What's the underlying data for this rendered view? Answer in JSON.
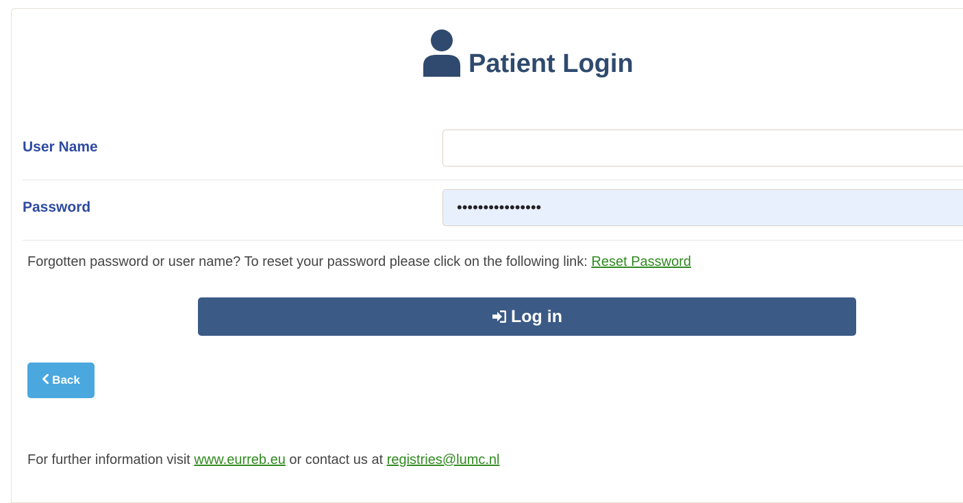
{
  "header": {
    "title": "Patient Login",
    "icon": "user-icon"
  },
  "form": {
    "username_label": "User Name",
    "username_value": "",
    "password_label": "Password",
    "password_value": "••••••••••••••••"
  },
  "forgot": {
    "text": "Forgotten password or user name? To reset your password please click on the following link: ",
    "link_label": "Reset Password"
  },
  "buttons": {
    "login_label": "Log in",
    "login_icon": "sign-in-icon",
    "back_label": "Back",
    "back_icon": "chevron-left-icon"
  },
  "footer": {
    "text_before": "For further information visit ",
    "website_link": "www.eurreb.eu",
    "text_middle": " or contact us at ",
    "email_link": "registries@lumc.nl"
  },
  "colors": {
    "title": "#2f4a6e",
    "label": "#2e4aa0",
    "link": "#2f8a1f",
    "login_button": "#3b5a86",
    "back_button": "#4aa8df",
    "password_field_bg": "#e8f0fe"
  }
}
